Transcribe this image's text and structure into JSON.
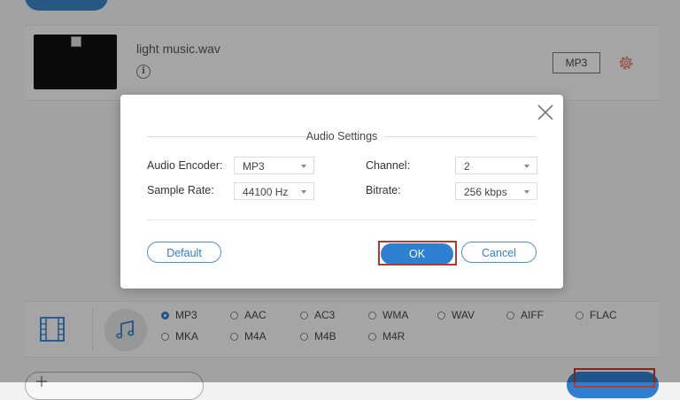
{
  "file": {
    "name": "light music.wav",
    "format_badge": "MP3"
  },
  "dialog": {
    "title": "Audio Settings",
    "fields": {
      "encoder": {
        "label": "Audio Encoder:",
        "value": "MP3"
      },
      "channel": {
        "label": "Channel:",
        "value": "2"
      },
      "sample_rate": {
        "label": "Sample Rate:",
        "value": "44100 Hz"
      },
      "bitrate": {
        "label": "Bitrate:",
        "value": "256 kbps"
      }
    },
    "buttons": {
      "default": "Default",
      "ok": "OK",
      "cancel": "Cancel"
    }
  },
  "formats": {
    "selected": "MP3",
    "options": [
      "MP3",
      "AAC",
      "AC3",
      "WMA",
      "WAV",
      "AIFF",
      "FLAC",
      "MKA",
      "M4A",
      "M4B",
      "M4R"
    ]
  },
  "colors": {
    "accent": "#2f7fd0",
    "highlight": "#b03a2e",
    "gear": "#e07a6a"
  },
  "icons": [
    "info-icon",
    "gear-icon",
    "film-icon",
    "music-note-icon",
    "close-icon",
    "plus-icon",
    "broken-image-icon"
  ]
}
